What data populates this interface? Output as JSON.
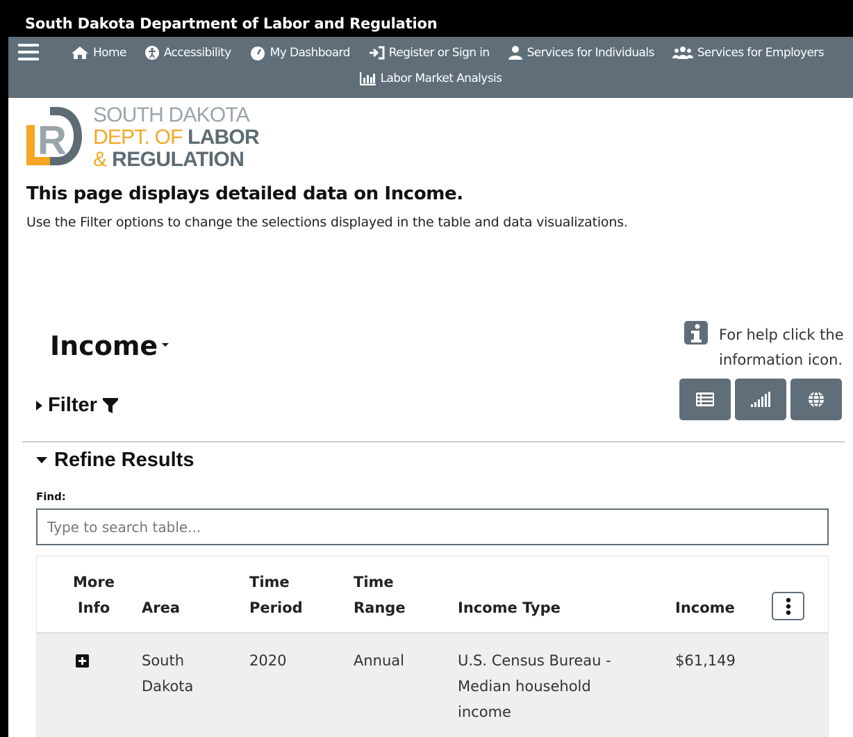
{
  "header": {
    "site_title": "South Dakota Department of Labor and Regulation"
  },
  "nav": {
    "items": [
      {
        "label": "Home",
        "icon": "home-icon"
      },
      {
        "label": "Accessibility",
        "icon": "accessibility-icon"
      },
      {
        "label": "My Dashboard",
        "icon": "dashboard-icon"
      },
      {
        "label": "Register or Sign in",
        "icon": "sign-in-icon"
      },
      {
        "label": "Services for Individuals",
        "icon": "user-icon"
      },
      {
        "label": "Services for Employers",
        "icon": "users-icon"
      },
      {
        "label": "Labor Market Analysis",
        "icon": "chart-icon"
      }
    ]
  },
  "logo": {
    "line1": "SOUTH DAKOTA",
    "line2a": "DEPT. OF",
    "line2b": "LABOR",
    "line3a": "&",
    "line3b": "REGULATION",
    "mark_letter": "R"
  },
  "intro": {
    "heading": "This page displays detailed data on Income.",
    "text": "Use the Filter options to change the selections displayed in the table and data visualizations."
  },
  "topic": {
    "title": "Income"
  },
  "help": {
    "text": "For help click the information icon."
  },
  "filter": {
    "label": "Filter"
  },
  "refine": {
    "label": "Refine Results",
    "find_label": "Find:",
    "search_placeholder": "Type to search table..."
  },
  "table": {
    "headers": {
      "more_info_1": "More",
      "more_info_2": "Info",
      "area": "Area",
      "period_1": "Time",
      "period_2": "Period",
      "range_1": "Time",
      "range_2": "Range",
      "type": "Income Type",
      "income": "Income"
    },
    "rows": [
      {
        "area_1": "South",
        "area_2": "Dakota",
        "period": "2020",
        "range": "Annual",
        "type_1": "U.S. Census Bureau -",
        "type_2": "Median household",
        "type_3": "income",
        "income": "$61,149"
      }
    ]
  },
  "colors": {
    "nav_bg": "#5f6e79",
    "accent_orange": "#f3a723",
    "title_bar": "#000000"
  }
}
